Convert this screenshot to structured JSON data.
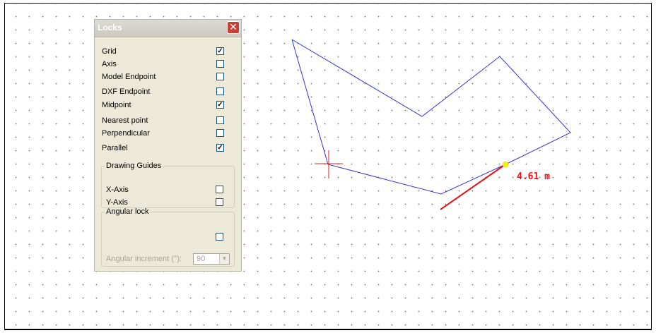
{
  "locks_panel": {
    "title": "Locks",
    "items": [
      {
        "label": "Grid",
        "checked": true
      },
      {
        "label": "Axis",
        "checked": false
      },
      {
        "label": "Model Endpoint",
        "checked": false
      },
      {
        "label": "DXF Endpoint",
        "checked": false
      },
      {
        "label": "Midpoint",
        "checked": true
      },
      {
        "label": "Nearest point",
        "checked": false
      },
      {
        "label": "Perpendicular",
        "checked": false
      },
      {
        "label": "Parallel",
        "checked": true
      }
    ],
    "drawing_guides": {
      "legend": "Drawing Guides",
      "items": [
        {
          "label": "X-Axis",
          "checked": false
        },
        {
          "label": "Y-Axis",
          "checked": false
        }
      ]
    },
    "angular_lock": {
      "legend": "Angular lock",
      "checked": false,
      "increment_label": "Angular increment (°):",
      "increment_value": "90"
    }
  },
  "drawing": {
    "measurement_label": "4.61 m",
    "polyline_color": "#3333dd",
    "active_segment_color": "#e81010",
    "cursor_color": "#e02020",
    "snap_point_color": "#ffee00"
  }
}
